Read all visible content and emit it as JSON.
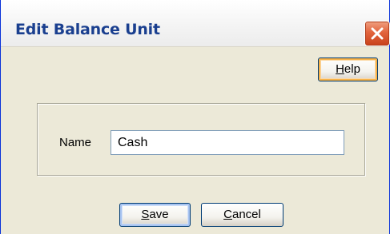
{
  "window": {
    "title": "Edit Balance Unit",
    "close_icon": "close-icon"
  },
  "toolbar": {
    "help_mnemonic": "H",
    "help_rest": "elp"
  },
  "form": {
    "name_label": "Name",
    "name_value": "Cash"
  },
  "footer": {
    "save_mnemonic": "S",
    "save_rest": "ave",
    "cancel_mnemonic": "C",
    "cancel_rest": "ancel"
  },
  "colors": {
    "title_text": "#1a3f8f",
    "close_button": "#e2643d",
    "dialog_background": "#ece9d8",
    "focus_ring_help": "#f8b34a",
    "focus_ring_save": "#a7c3f0"
  }
}
